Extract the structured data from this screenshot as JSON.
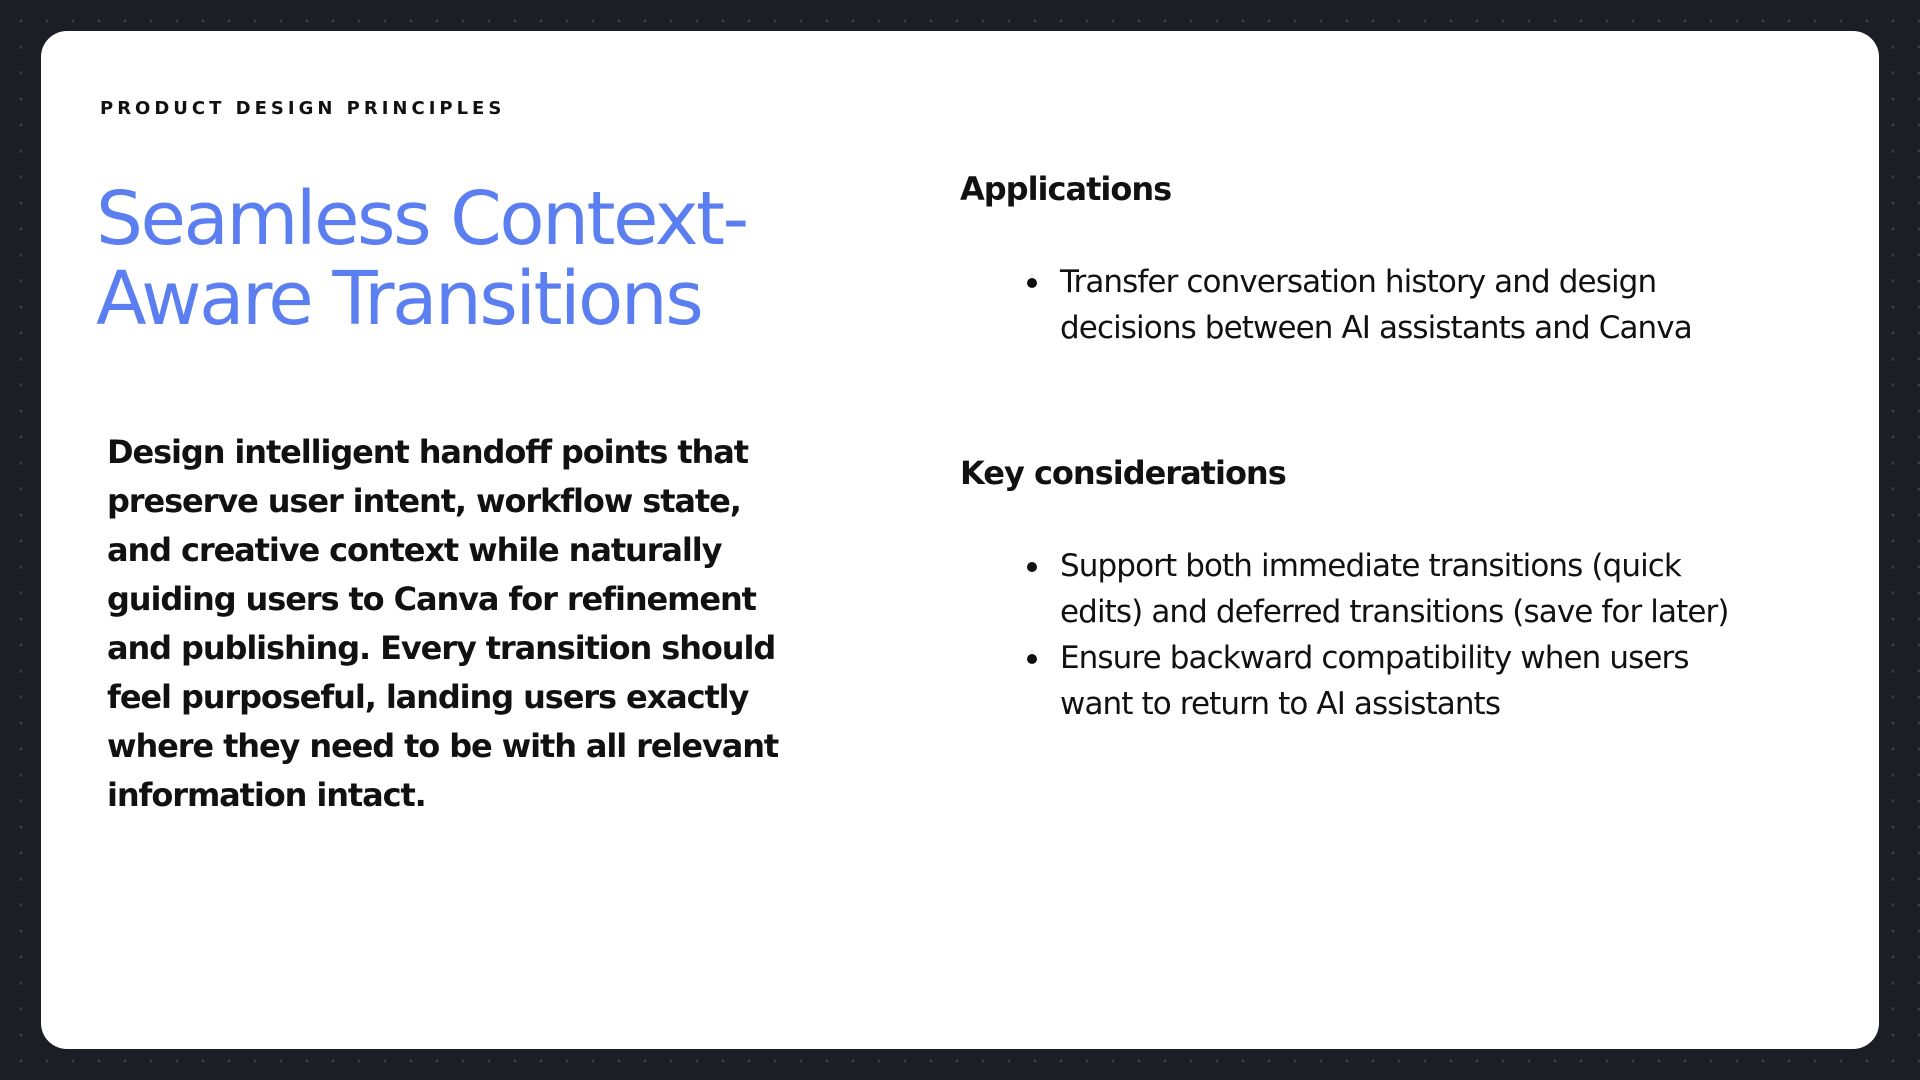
{
  "slide": {
    "eyebrow": "PRODUCT DESIGN PRINCIPLES",
    "title_lines": [
      "Seamless Context-",
      "Aware Transitions"
    ],
    "description_lines": [
      "Design intelligent handoff points that",
      "preserve user intent, workflow state,",
      "and creative context while naturally",
      "guiding users to Canva for refinement",
      "and publishing. Every transition should",
      "feel purposeful, landing users exactly",
      "where they need to be with all relevant",
      "information intact."
    ],
    "applications": {
      "heading": "Applications",
      "items": [
        {
          "lines": [
            "Transfer conversation history and design",
            "decisions between AI assistants and Canva"
          ]
        }
      ]
    },
    "considerations": {
      "heading": "Key considerations",
      "items": [
        {
          "lines": [
            "Support both immediate transitions (quick",
            "edits) and deferred transitions (save for later)"
          ]
        },
        {
          "lines": [
            "Ensure backward compatibility when users",
            "want to return to AI assistants"
          ]
        }
      ]
    }
  },
  "colors": {
    "background": "#1b1e25",
    "card": "#ffffff",
    "accent_title": "#5b7ff0",
    "text": "#111111"
  }
}
